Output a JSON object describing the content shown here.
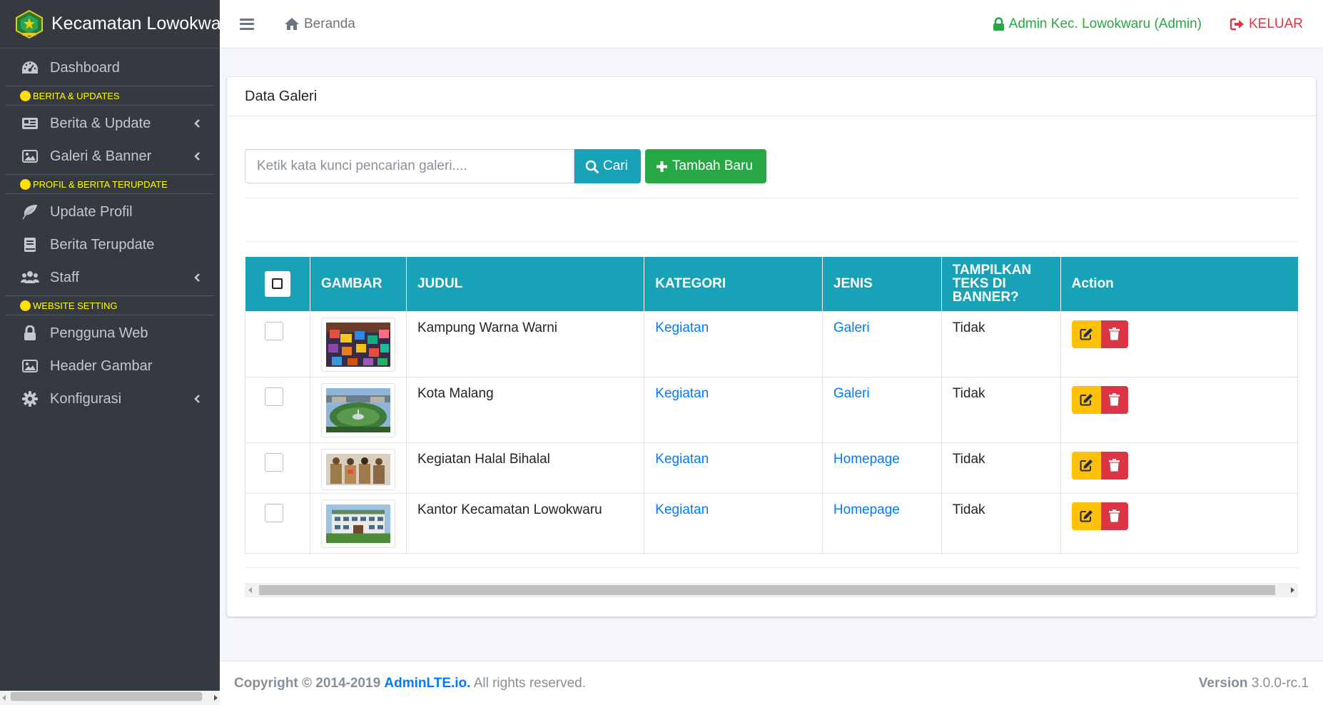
{
  "brand": {
    "name": "Kecamatan Lowokwaru"
  },
  "sidebar": {
    "items": [
      {
        "type": "item",
        "label": "Dashboard",
        "icon": "tachometer-icon",
        "has_children": false
      },
      {
        "type": "header",
        "label": "BERITA & UPDATES"
      },
      {
        "type": "item",
        "label": "Berita & Update",
        "icon": "newspaper-icon",
        "has_children": true
      },
      {
        "type": "item",
        "label": "Galeri & Banner",
        "icon": "image-icon",
        "has_children": true
      },
      {
        "type": "header",
        "label": "PROFIL & BERITA TERUPDATE"
      },
      {
        "type": "item",
        "label": "Update Profil",
        "icon": "leaf-icon",
        "has_children": false
      },
      {
        "type": "item",
        "label": "Berita Terupdate",
        "icon": "book-icon",
        "has_children": false
      },
      {
        "type": "item",
        "label": "Staff",
        "icon": "users-icon",
        "has_children": true
      },
      {
        "type": "header",
        "label": "WEBSITE SETTING"
      },
      {
        "type": "item",
        "label": "Pengguna Web",
        "icon": "lock-icon",
        "has_children": false
      },
      {
        "type": "item",
        "label": "Header Gambar",
        "icon": "image-icon",
        "has_children": false
      },
      {
        "type": "item",
        "label": "Konfigurasi",
        "icon": "gear-icon",
        "has_children": true
      }
    ]
  },
  "navbar": {
    "home_label": "Beranda",
    "admin_label": "Admin Kec. Lowokwaru (Admin)",
    "logout_label": "KELUAR"
  },
  "card": {
    "title": "Data Galeri",
    "search_placeholder": "Ketik kata kunci pencarian galeri....",
    "search_button": "Cari",
    "add_button": "Tambah Baru"
  },
  "table": {
    "columns": [
      "GAMBAR",
      "JUDUL",
      "KATEGORI",
      "JENIS",
      "TAMPILKAN TEKS DI BANNER?",
      "Action"
    ],
    "rows": [
      {
        "judul": "Kampung Warna Warni",
        "kategori": "Kegiatan",
        "jenis": "Galeri",
        "tampilkan": "Tidak",
        "image": "colorful-village-photo"
      },
      {
        "judul": "Kota Malang",
        "kategori": "Kegiatan",
        "jenis": "Galeri",
        "tampilkan": "Tidak",
        "image": "city-square-photo"
      },
      {
        "judul": "Kegiatan Halal Bihalal",
        "kategori": "Kegiatan",
        "jenis": "Homepage",
        "tampilkan": "Tidak",
        "image": "people-group-photo"
      },
      {
        "judul": "Kantor Kecamatan Lowokwaru",
        "kategori": "Kegiatan",
        "jenis": "Homepage",
        "tampilkan": "Tidak",
        "image": "office-building-photo"
      }
    ]
  },
  "footer": {
    "copyright_prefix": "Copyright © 2014-2019",
    "link": "AdminLTE.io.",
    "suffix": "All rights reserved.",
    "version_label": "Version",
    "version": "3.0.0-rc.1"
  },
  "colors": {
    "sidebar_bg": "#343a40",
    "info": "#17a2b8",
    "success": "#28a745",
    "danger": "#dc3545",
    "warning": "#ffc107",
    "link": "#007bff",
    "header_yellow": "#ffff00"
  }
}
